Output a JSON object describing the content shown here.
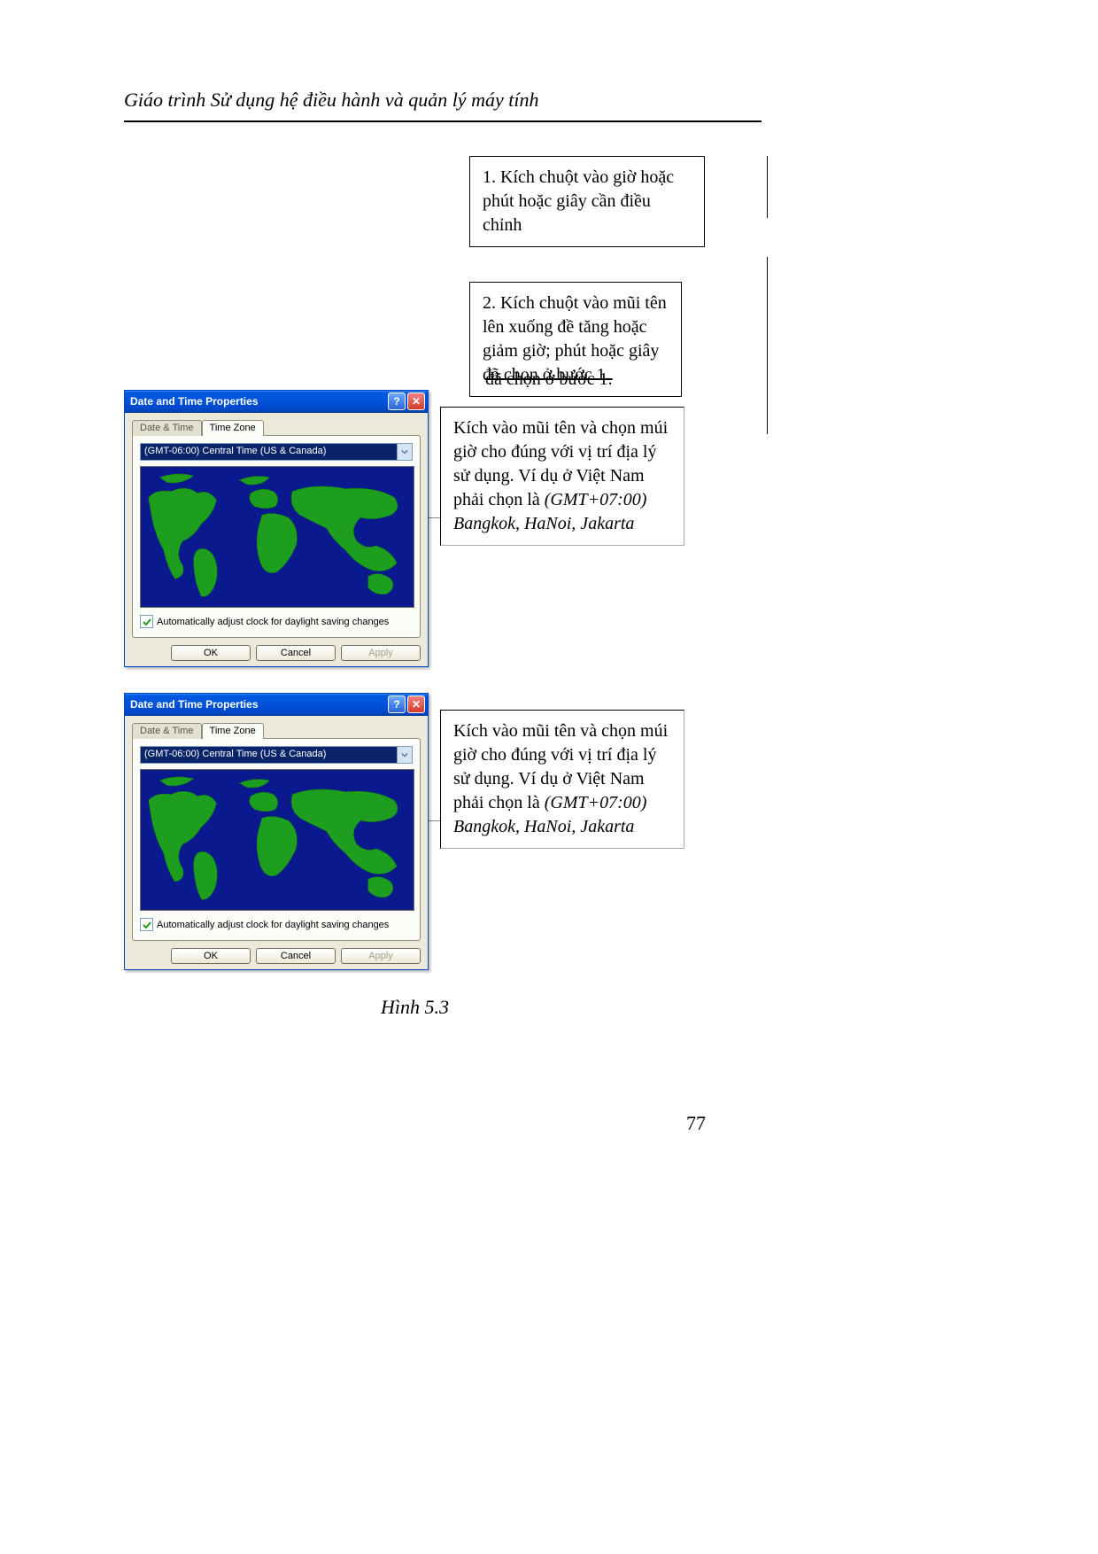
{
  "document": {
    "header": "Giáo trình Sử dụng hệ điều hành và quản lý máy tính",
    "page_number": "77",
    "figure_caption": "Hình 5.3"
  },
  "callouts": {
    "c1": "1. Kích chuột vào giờ hoặc phút hoặc giây cần điều chỉnh",
    "c2": "2. Kích chuột vào mũi tên lên xuống đề tăng hoặc giảm giờ; phút hoặc giây đã chọn ở bước 1.",
    "c2_trail": "đã chọn ở bước 1.",
    "c3_a": "Kích vào mũi tên và chọn múi giờ cho đúng với vị trí địa lý sử dụng. Ví dụ ở Việt Nam phải chọn là ",
    "c3_b": "(GMT+07:00) Bangkok, HaNoi, Jakarta",
    "c4_a": "Kích vào mũi tên và chọn múi giờ cho đúng với vị trí địa lý sử dụng. Ví dụ ở Việt Nam phải chọn là ",
    "c4_b": "(GMT+07:00) Bangkok, HaNoi, Jakarta"
  },
  "dialog": {
    "title": "Date and Time Properties",
    "tabs": {
      "t1": "Date & Time",
      "t2": "Time Zone"
    },
    "combo_text": "(GMT-06:00) Central Time (US & Canada)",
    "checkbox_label": "Automatically adjust clock for daylight saving changes",
    "buttons": {
      "ok": "OK",
      "cancel": "Cancel",
      "apply": "Apply"
    }
  }
}
